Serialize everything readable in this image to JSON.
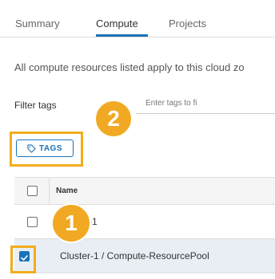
{
  "tabs": [
    {
      "label": "Summary",
      "active": false
    },
    {
      "label": "Compute",
      "active": true
    },
    {
      "label": "Projects",
      "active": false
    }
  ],
  "description": "All compute resources listed apply to this cloud zo",
  "filter": {
    "label": "Filter tags",
    "placeholder": "Enter tags to fi"
  },
  "tags_button": {
    "label": "TAGS",
    "icon": "tag-icon"
  },
  "callouts": [
    "2",
    "1"
  ],
  "grid": {
    "column_name": "Name",
    "rows": [
      {
        "name": "Cluster-1",
        "checked": false
      },
      {
        "name": "Cluster-1 / Compute-ResourcePool",
        "checked": true
      }
    ]
  },
  "colors": {
    "accent": "#1a73b9",
    "highlight": "#f2ad1c",
    "callout": "#f1a923",
    "selected_row": "#e8eef4"
  }
}
